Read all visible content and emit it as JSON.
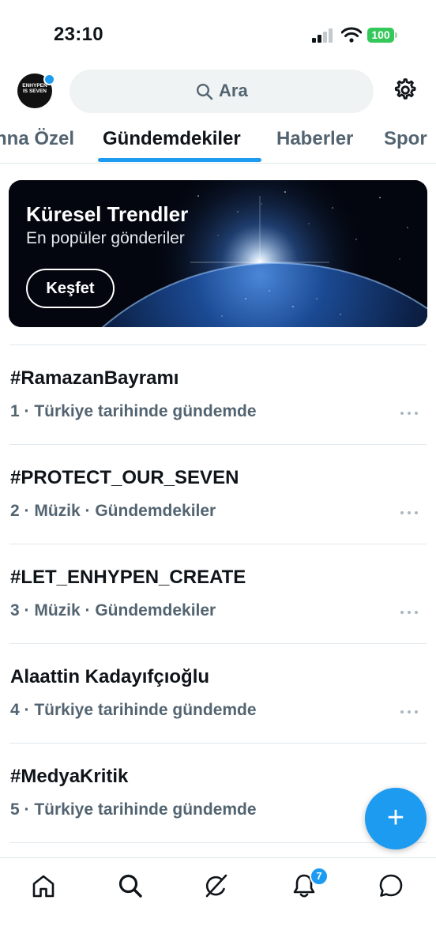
{
  "status_bar": {
    "time": "23:10",
    "battery": "100",
    "icons": [
      "signal-icon",
      "wifi-icon",
      "battery-icon"
    ]
  },
  "header": {
    "avatar_text_line1": "ENHYPEN",
    "avatar_text_line2": "IS SEVEN",
    "search_placeholder": "Ara",
    "icons": [
      "search-icon",
      "gear-icon"
    ]
  },
  "tabs": [
    {
      "label": "nna Özel"
    },
    {
      "label": "Gündemdekiler",
      "active": true
    },
    {
      "label": "Haberler"
    },
    {
      "label": "Spor"
    }
  ],
  "banner": {
    "title": "Küresel Trendler",
    "subtitle": "En popüler gönderiler",
    "button": "Keşfet"
  },
  "trends": [
    {
      "name": "#RamazanBayramı",
      "meta": "1 · Türkiye tarihinde gündemde"
    },
    {
      "name": "#PROTECT_OUR_SEVEN",
      "meta": "2 · Müzik · Gündemdekiler"
    },
    {
      "name": "#LET_ENHYPEN_CREATE",
      "meta": "3 · Müzik · Gündemdekiler"
    },
    {
      "name": "Alaattin Kadayıfçıoğlu",
      "meta": "4 · Türkiye tarihinde gündemde"
    },
    {
      "name": "#MedyaKritik",
      "meta": "5 · Türkiye tarihinde gündemde"
    }
  ],
  "fab": {
    "label": "+"
  },
  "bottom_nav": {
    "items": [
      "home-icon",
      "search-icon",
      "grok-icon",
      "bell-icon",
      "messages-icon"
    ],
    "notification_badge": "7"
  },
  "colors": {
    "accent": "#1d9bf0",
    "text": "#0f1419",
    "secondary": "#536471",
    "battery": "#34c759"
  }
}
